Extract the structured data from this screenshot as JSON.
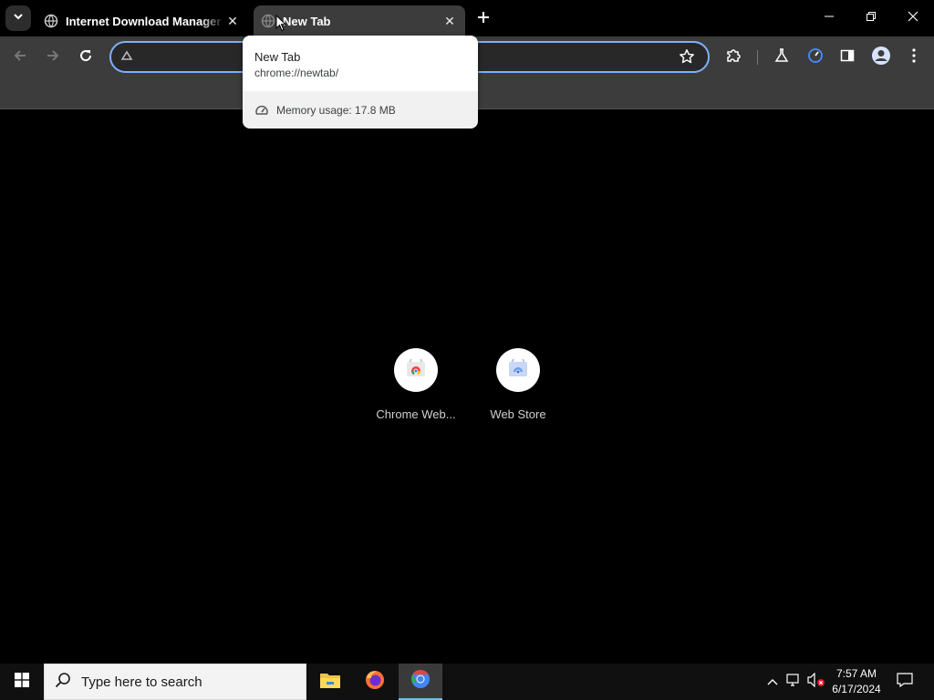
{
  "tabs": [
    {
      "title": "Internet Download Manager is",
      "active": false
    },
    {
      "title": "New Tab",
      "active": true
    }
  ],
  "hovercard": {
    "title": "New Tab",
    "url": "chrome://newtab/",
    "memory": "Memory usage: 17.8 MB"
  },
  "shortcuts": [
    {
      "label": "Chrome Web..."
    },
    {
      "label": "Web Store"
    }
  ],
  "taskbar": {
    "search_placeholder": "Type here to search",
    "time": "7:57 AM",
    "date": "6/17/2024"
  },
  "colors": {
    "accent_focus": "#7eb0ff",
    "toolbar": "#3c3c3c",
    "taskbar_active": "#76b9ed"
  }
}
